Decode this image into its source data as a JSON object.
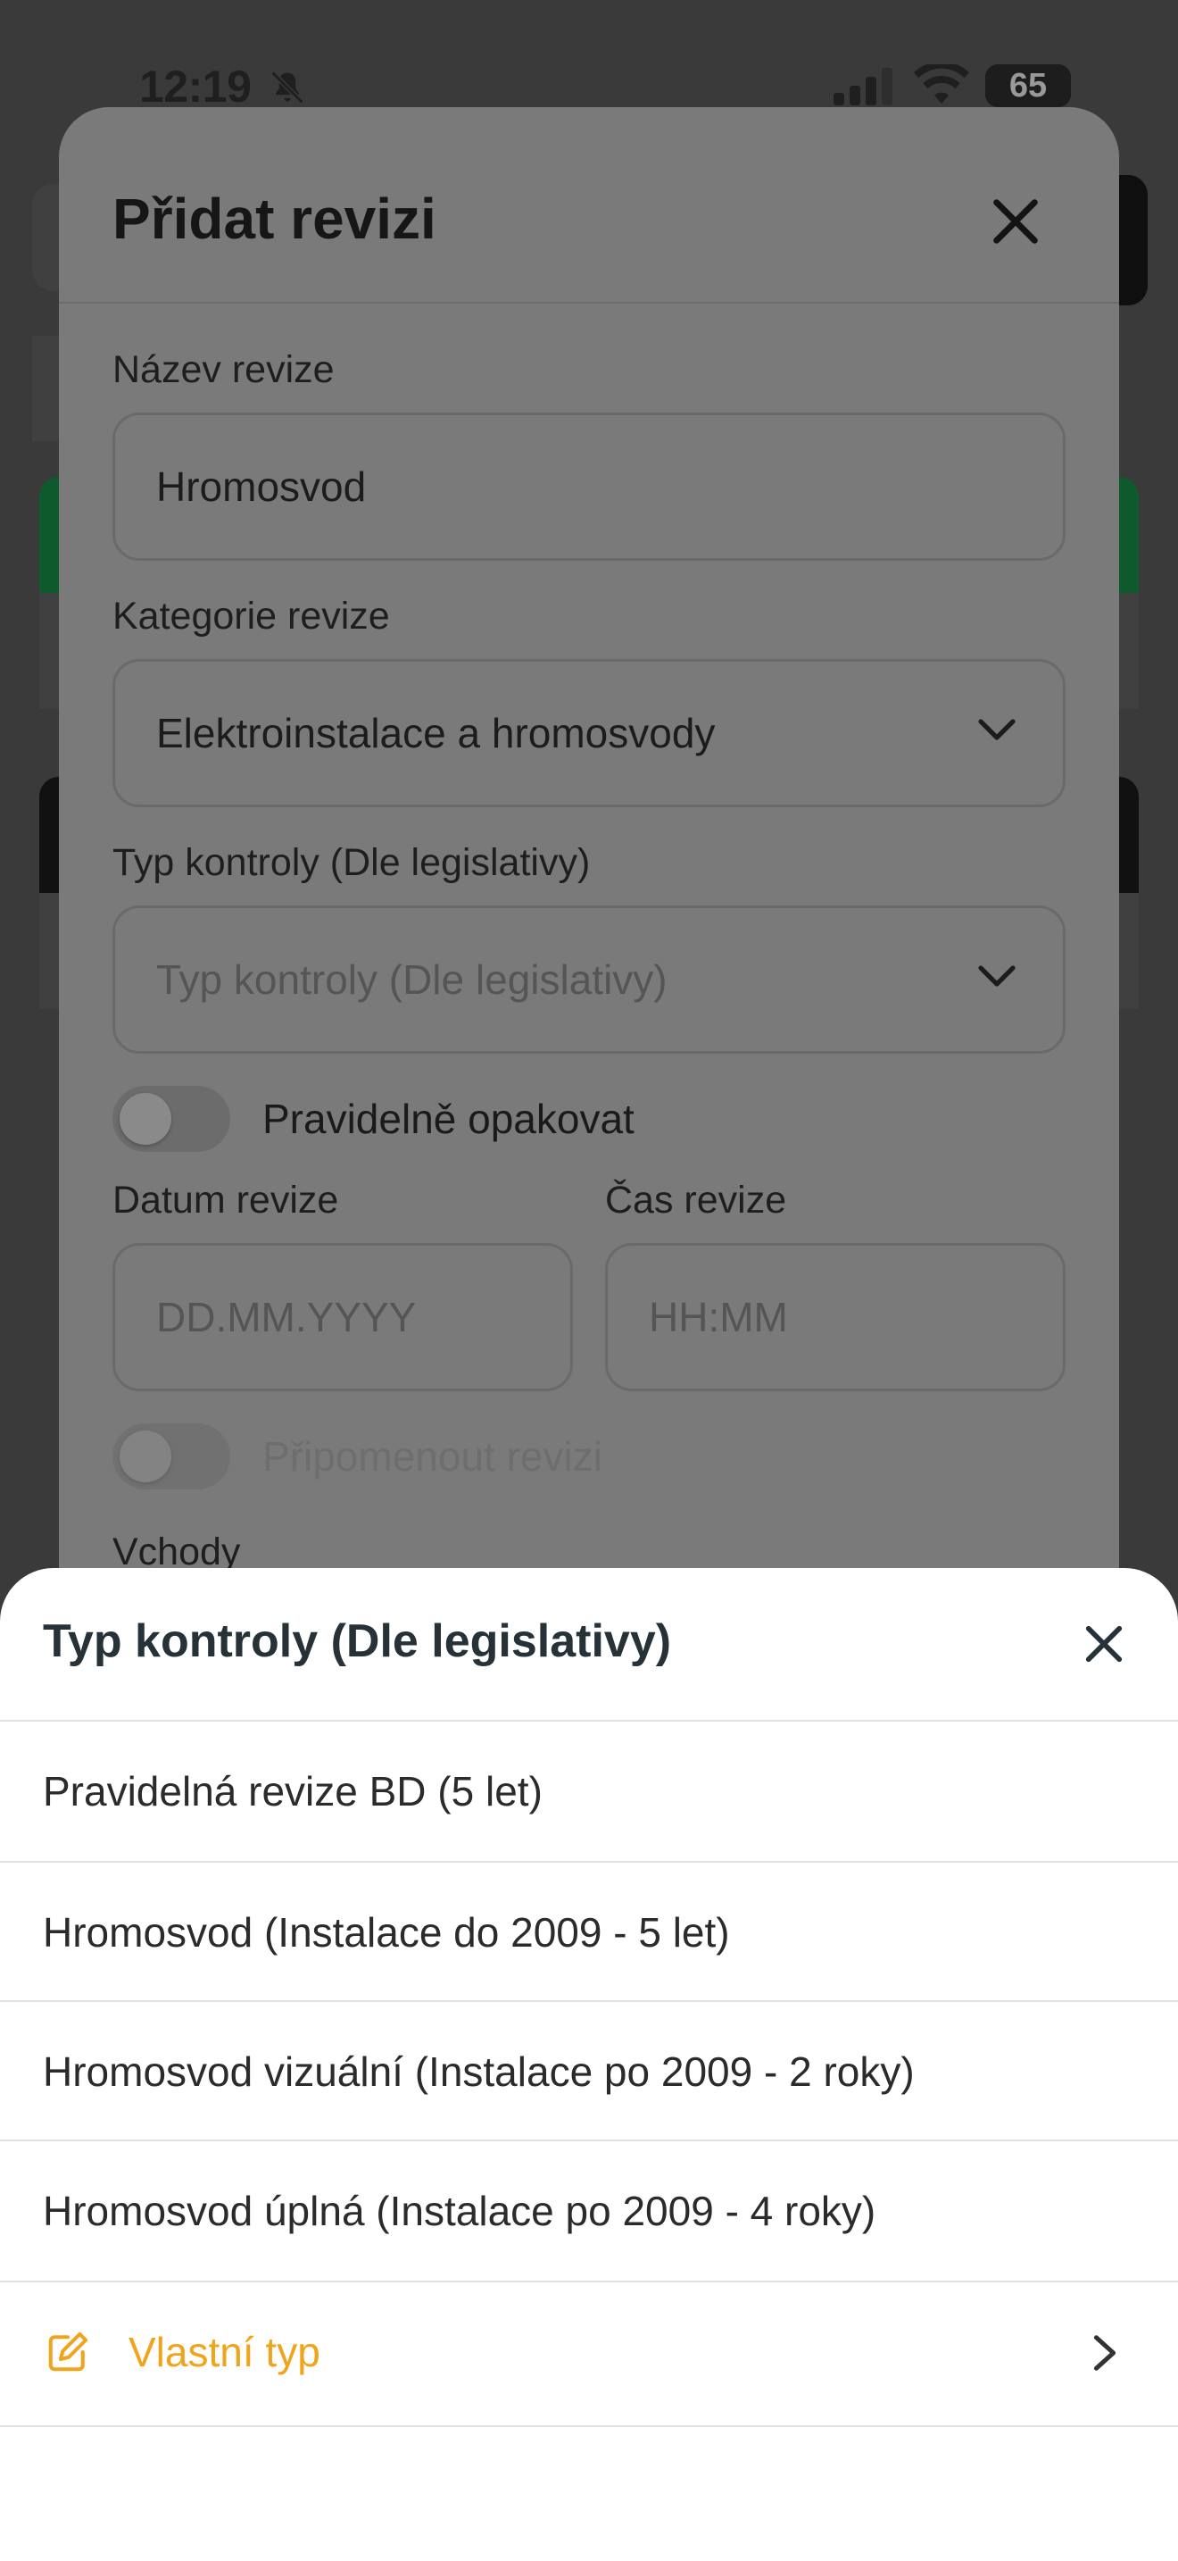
{
  "status_bar": {
    "time": "12:19",
    "battery": "65"
  },
  "modal": {
    "title": "Přidat revizi",
    "fields": {
      "name": {
        "label": "Název revize",
        "value": "Hromosvod"
      },
      "category": {
        "label": "Kategorie revize",
        "value": "Elektroinstalace a hromosvody"
      },
      "control_type": {
        "label": "Typ kontroly (Dle legislativy)",
        "placeholder": "Typ kontroly (Dle legislativy)"
      },
      "repeat": {
        "label": "Pravidelně opakovat"
      },
      "date": {
        "label": "Datum revize",
        "placeholder": "DD.MM.YYYY"
      },
      "time": {
        "label": "Čas revize",
        "placeholder": "HH:MM"
      },
      "remind": {
        "label": "Připomenout revizi"
      },
      "entrances": {
        "label": "Vchody"
      }
    }
  },
  "sheet": {
    "title": "Typ kontroly (Dle legislativy)",
    "options": [
      "Pravidelná revize BD (5 let)",
      "Hromosvod (Instalace do 2009 - 5 let)",
      "Hromosvod vizuální (Instalace po 2009 - 2 roky)",
      "Hromosvod úplná (Instalace po 2009 - 4 roky)"
    ],
    "custom_label": "Vlastní typ",
    "accent_color": "#f0a41b"
  }
}
